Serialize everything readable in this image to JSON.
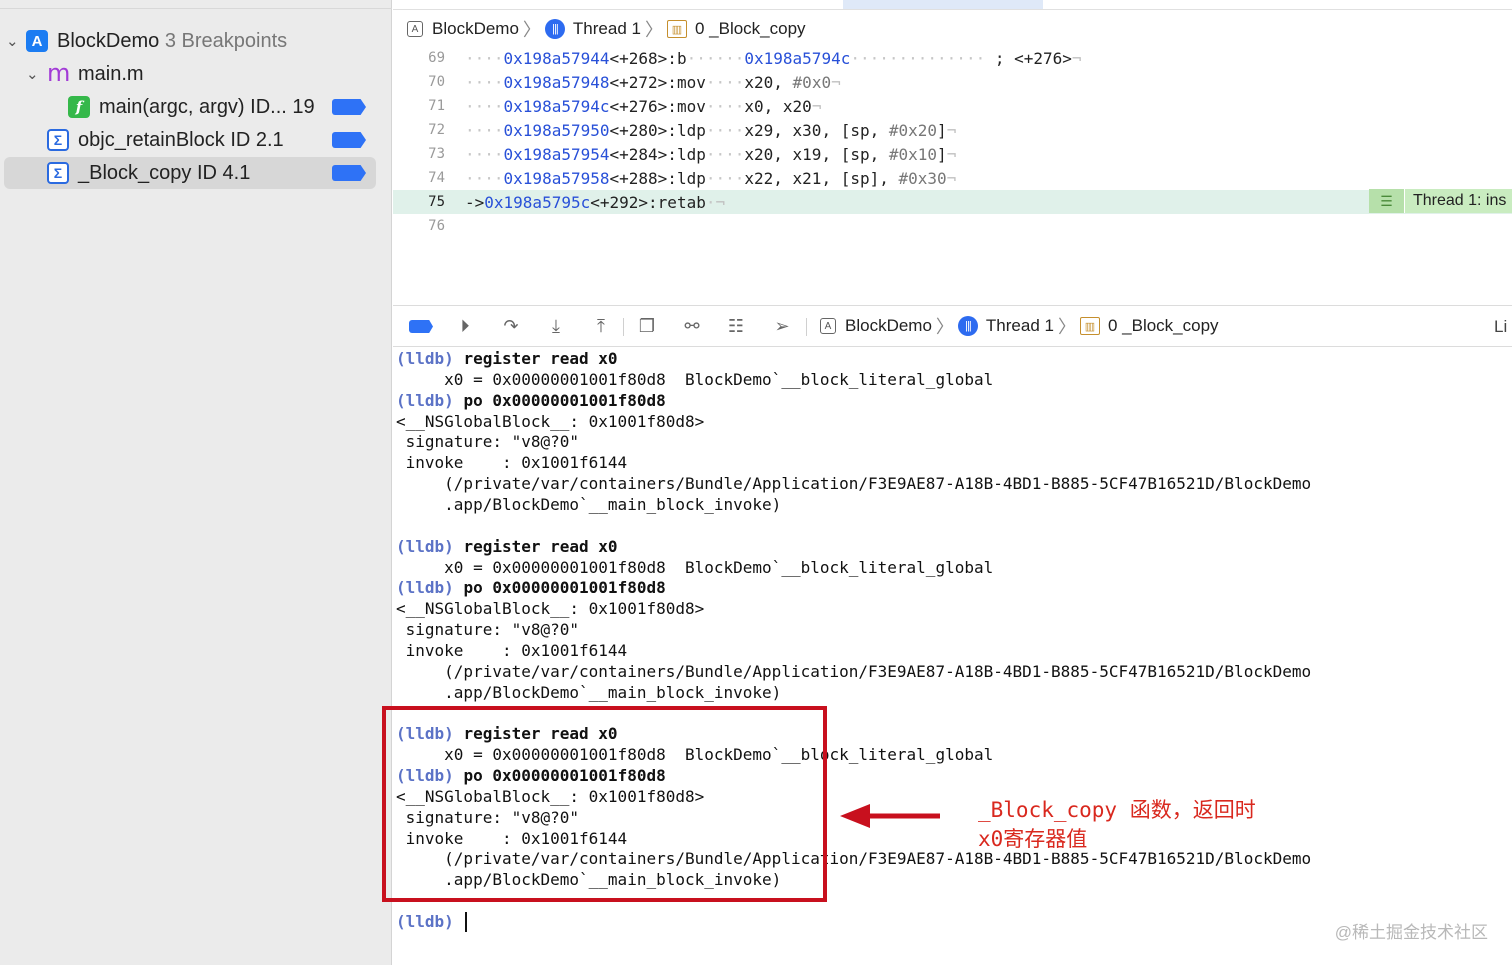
{
  "sidebar": {
    "project": {
      "name": "BlockDemo",
      "count": "3 Breakpoints"
    },
    "file": {
      "glyph": "m",
      "name": "main.m"
    },
    "breakpoints": [
      {
        "icon": "f",
        "label": "main(argc, argv)",
        "sub": "ID... 19"
      },
      {
        "icon": "Σ",
        "label": "objc_retainBlock",
        "sub": "ID 2.1"
      },
      {
        "icon": "Σ",
        "label": "_Block_copy",
        "sub": "ID 4.1"
      }
    ]
  },
  "jumpbar": {
    "project": "BlockDemo",
    "thread": "Thread 1",
    "frame": "0 _Block_copy"
  },
  "code": [
    {
      "ln": "69",
      "addr": "0x198a57944",
      "off": "<+268>:",
      "op": "b",
      "args": "0x198a5794c",
      "comment": "; <+276>"
    },
    {
      "ln": "70",
      "addr": "0x198a57948",
      "off": "<+272>:",
      "op": "mov",
      "args": "x20, ",
      "imm": "#0x0"
    },
    {
      "ln": "71",
      "addr": "0x198a5794c",
      "off": "<+276>:",
      "op": "mov",
      "args": "x0, x20"
    },
    {
      "ln": "72",
      "addr": "0x198a57950",
      "off": "<+280>:",
      "op": "ldp",
      "args": "x29, x30, [sp, ",
      "imm": "#0x20",
      "tail": "]"
    },
    {
      "ln": "73",
      "addr": "0x198a57954",
      "off": "<+284>:",
      "op": "ldp",
      "args": "x20, x19, [sp, ",
      "imm": "#0x10",
      "tail": "]"
    },
    {
      "ln": "74",
      "addr": "0x198a57958",
      "off": "<+288>:",
      "op": "ldp",
      "args": "x22, x21, [sp], ",
      "imm": "#0x30"
    },
    {
      "ln": "75",
      "addr": "0x198a5795c",
      "off": "<+292>:",
      "op": "retab",
      "current": true
    },
    {
      "ln": "76"
    }
  ],
  "thread_badge": "Thread 1: ins",
  "debugbar": {
    "project": "BlockDemo",
    "thread": "Thread 1",
    "frame": "0 _Block_copy",
    "right": "Li"
  },
  "console": [
    {
      "prompt": "(lldb)",
      "cmd": "register read x0"
    },
    {
      "text": "     x0 = 0x00000001001f80d8  BlockDemo`__block_literal_global"
    },
    {
      "prompt": "(lldb)",
      "cmd": "po 0x00000001001f80d8"
    },
    {
      "text": "<__NSGlobalBlock__: 0x1001f80d8>"
    },
    {
      "text": " signature: \"v8@?0\""
    },
    {
      "text": " invoke    : 0x1001f6144"
    },
    {
      "text": "     (/private/var/containers/Bundle/Application/F3E9AE87-A18B-4BD1-B885-5CF47B16521D/BlockDemo"
    },
    {
      "text": "     .app/BlockDemo`__main_block_invoke)"
    },
    {
      "text": ""
    },
    {
      "prompt": "(lldb)",
      "cmd": "register read x0"
    },
    {
      "text": "     x0 = 0x00000001001f80d8  BlockDemo`__block_literal_global"
    },
    {
      "prompt": "(lldb)",
      "cmd": "po 0x00000001001f80d8"
    },
    {
      "text": "<__NSGlobalBlock__: 0x1001f80d8>"
    },
    {
      "text": " signature: \"v8@?0\""
    },
    {
      "text": " invoke    : 0x1001f6144"
    },
    {
      "text": "     (/private/var/containers/Bundle/Application/F3E9AE87-A18B-4BD1-B885-5CF47B16521D/BlockDemo"
    },
    {
      "text": "     .app/BlockDemo`__main_block_invoke)"
    },
    {
      "text": ""
    },
    {
      "prompt": "(lldb)",
      "cmd": "register read x0"
    },
    {
      "text": "     x0 = 0x00000001001f80d8  BlockDemo`__block_literal_global"
    },
    {
      "prompt": "(lldb)",
      "cmd": "po 0x00000001001f80d8"
    },
    {
      "text": "<__NSGlobalBlock__: 0x1001f80d8>"
    },
    {
      "text": " signature: \"v8@?0\""
    },
    {
      "text": " invoke    : 0x1001f6144"
    },
    {
      "text": "     (/private/var/containers/Bundle/Application/F3E9AE87-A18B-4BD1-B885-5CF47B16521D/BlockDemo"
    },
    {
      "text": "     .app/BlockDemo`__main_block_invoke)"
    },
    {
      "text": ""
    },
    {
      "prompt": "(lldb)",
      "cmd": ""
    }
  ],
  "annotation": {
    "line1": "_Block_copy 函数，返回时",
    "line2": "x0寄存器值"
  },
  "watermark": "@稀土掘金技术社区",
  "colors": {
    "accent": "#2e72f6",
    "highlight": "#c8101e",
    "current_line": "#e0f1ea",
    "prompt": "#5b72c6"
  }
}
